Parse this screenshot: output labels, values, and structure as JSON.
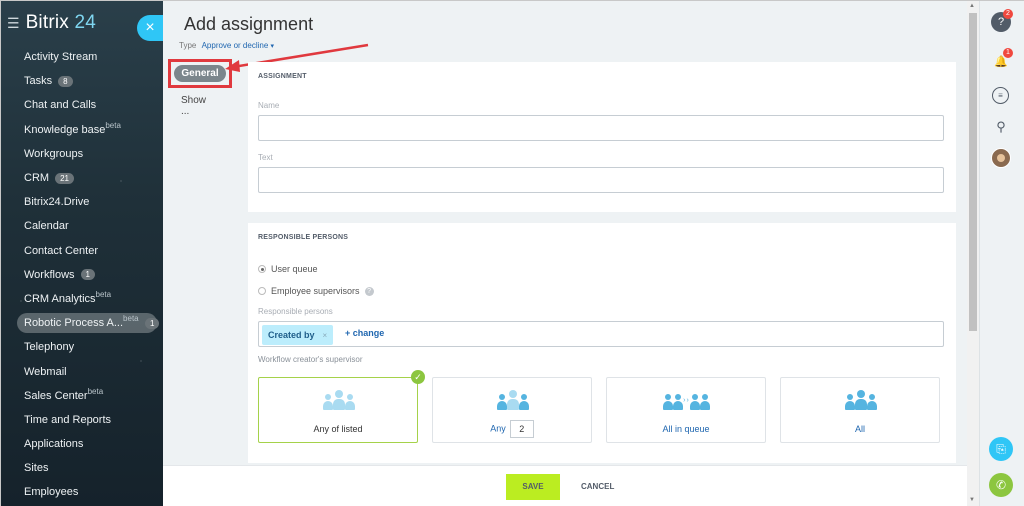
{
  "sidebar": {
    "logo_prefix": "Bitrix",
    "logo_number": "24",
    "items": [
      {
        "label": "Activity Stream",
        "sup": "",
        "count": ""
      },
      {
        "label": "Tasks",
        "sup": "",
        "count": "8"
      },
      {
        "label": "Chat and Calls",
        "sup": "",
        "count": ""
      },
      {
        "label": "Knowledge base",
        "sup": "beta",
        "count": ""
      },
      {
        "label": "Workgroups",
        "sup": "",
        "count": ""
      },
      {
        "label": "CRM",
        "sup": "",
        "count": "21"
      },
      {
        "label": "Bitrix24.Drive",
        "sup": "",
        "count": ""
      },
      {
        "label": "Calendar",
        "sup": "",
        "count": ""
      },
      {
        "label": "Contact Center",
        "sup": "",
        "count": ""
      },
      {
        "label": "Workflows",
        "sup": "",
        "count": "1"
      },
      {
        "label": "CRM Analytics",
        "sup": "beta",
        "count": ""
      },
      {
        "label": "Robotic Process A...",
        "sup": "beta",
        "count": "1"
      },
      {
        "label": "Telephony",
        "sup": "",
        "count": ""
      },
      {
        "label": "Webmail",
        "sup": "",
        "count": ""
      },
      {
        "label": "Sales Center",
        "sup": "beta",
        "count": ""
      },
      {
        "label": "Time and Reports",
        "sup": "",
        "count": ""
      },
      {
        "label": "Applications",
        "sup": "",
        "count": ""
      },
      {
        "label": "Sites",
        "sup": "",
        "count": ""
      },
      {
        "label": "Employees",
        "sup": "",
        "count": ""
      }
    ],
    "active_index": 11
  },
  "close_button": "×",
  "panel": {
    "title": "Add assignment",
    "type_label": "Type",
    "type_value": "Approve or decline",
    "tabs": {
      "general": "General",
      "show": "Show ..."
    },
    "assignment": {
      "section_title": "ASSIGNMENT",
      "name_label": "Name",
      "name_value": "",
      "text_label": "Text",
      "text_value": ""
    },
    "responsible": {
      "section_title": "RESPONSIBLE PERSONS",
      "radio_user_queue": "User queue",
      "radio_supervisors": "Employee supervisors",
      "selected_radio": "User queue",
      "persons_label": "Responsible persons",
      "tag": "Created by",
      "tag_remove": "×",
      "change_link": "+ change",
      "supervisor_label": "Workflow creator's supervisor",
      "options": [
        {
          "label": "Any of listed",
          "selected": true
        },
        {
          "label": "Any",
          "value": "2",
          "selected": false
        },
        {
          "label": "All in queue",
          "selected": false
        },
        {
          "label": "All",
          "selected": false
        }
      ]
    },
    "footer": {
      "save": "SAVE",
      "cancel": "CANCEL"
    }
  },
  "rightbar": {
    "help_badge": "2",
    "notify_badge": "1"
  },
  "colors": {
    "accent": "#2fc6f6",
    "save_button": "#bbed21",
    "highlight": "#e0393e",
    "link": "#2067b0"
  }
}
